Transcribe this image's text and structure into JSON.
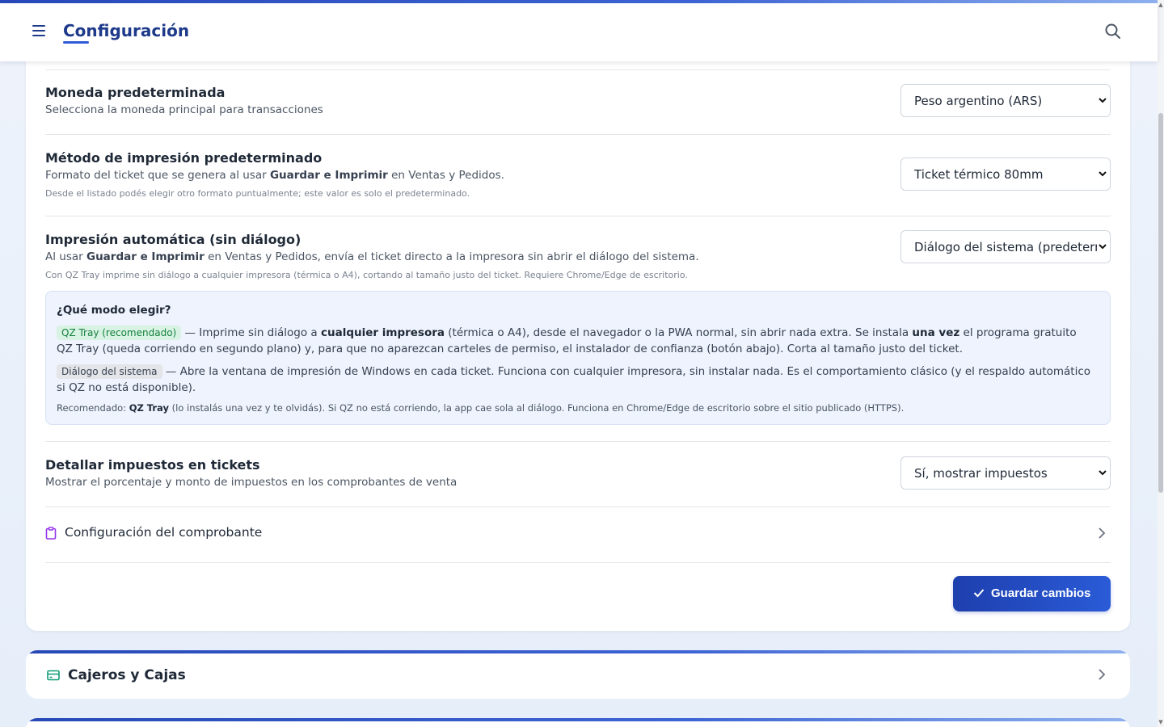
{
  "header": {
    "title": "Configuración",
    "menu_icon": "menu-icon",
    "search_icon": "search-icon"
  },
  "settings": {
    "currency": {
      "title": "Moneda predeterminada",
      "description": "Selecciona la moneda principal para transacciones",
      "selected": "Peso argentino (ARS)"
    },
    "print_method": {
      "title": "Método de impresión predeterminado",
      "description_pre": "Formato del ticket que se genera al usar ",
      "description_bold": "Guardar e Imprimir",
      "description_post": " en Ventas y Pedidos.",
      "note": "Desde el listado podés elegir otro formato puntualmente; este valor es solo el predeterminado.",
      "selected": "Ticket térmico 80mm"
    },
    "auto_print": {
      "title": "Impresión automática (sin diálogo)",
      "description_pre": "Al usar ",
      "description_bold": "Guardar e Imprimir",
      "description_post": " en Ventas y Pedidos, envía el ticket directo a la impresora sin abrir el diálogo del sistema.",
      "note": "Con QZ Tray imprime sin diálogo a cualquier impresora (térmica o A4), cortando al tamaño justo del ticket. Requiere Chrome/Edge de escritorio.",
      "selected": "Diálogo del sistema (predeterminado)"
    },
    "taxes": {
      "title": "Detallar impuestos en tickets",
      "description": "Mostrar el porcentaje y monto de impuestos en los comprobantes de venta",
      "selected": "Sí, mostrar impuestos"
    }
  },
  "info_box": {
    "title": "¿Qué modo elegir?",
    "qz": {
      "tag": "QZ Tray (recomendado)",
      "t1": " — Imprime sin diálogo a ",
      "b1": "cualquier impresora",
      "t2": " (térmica o A4), desde el navegador o la PWA normal, sin abrir nada extra. Se instala ",
      "b2": "una vez",
      "t3": " el programa gratuito QZ Tray (queda corriendo en segundo plano) y, para que no aparezcan carteles de permiso, el instalador de confianza (botón abajo). Corta al tamaño justo del ticket."
    },
    "system": {
      "tag": "Diálogo del sistema",
      "text": " — Abre la ventana de impresión de Windows en cada ticket. Funciona con cualquier impresora, sin instalar nada. Es el comportamiento clásico (y el respaldo automático si QZ no está disponible)."
    },
    "footer": {
      "pre": "Recomendado: ",
      "bold": "QZ Tray",
      "post": " (lo instalás una vez y te olvidás). Si QZ no está corriendo, la app cae sola al diálogo. Funciona en Chrome/Edge de escritorio sobre el sitio publicado (HTTPS)."
    }
  },
  "receipt_link": {
    "label": "Configuración del comprobante",
    "icon": "clipboard-icon"
  },
  "save_button": {
    "label": "Guardar cambios",
    "icon": "check-icon"
  },
  "cashiers_card": {
    "label": "Cajeros y Cajas",
    "icon": "credit-card-icon"
  },
  "colors": {
    "primary": "#1e3a8a",
    "accent": "#2a5bd7",
    "info_bg": "#eef3fd",
    "green_tag": "#15803d",
    "receipt_icon": "#9333ea",
    "cashier_icon": "#0f9d76"
  }
}
